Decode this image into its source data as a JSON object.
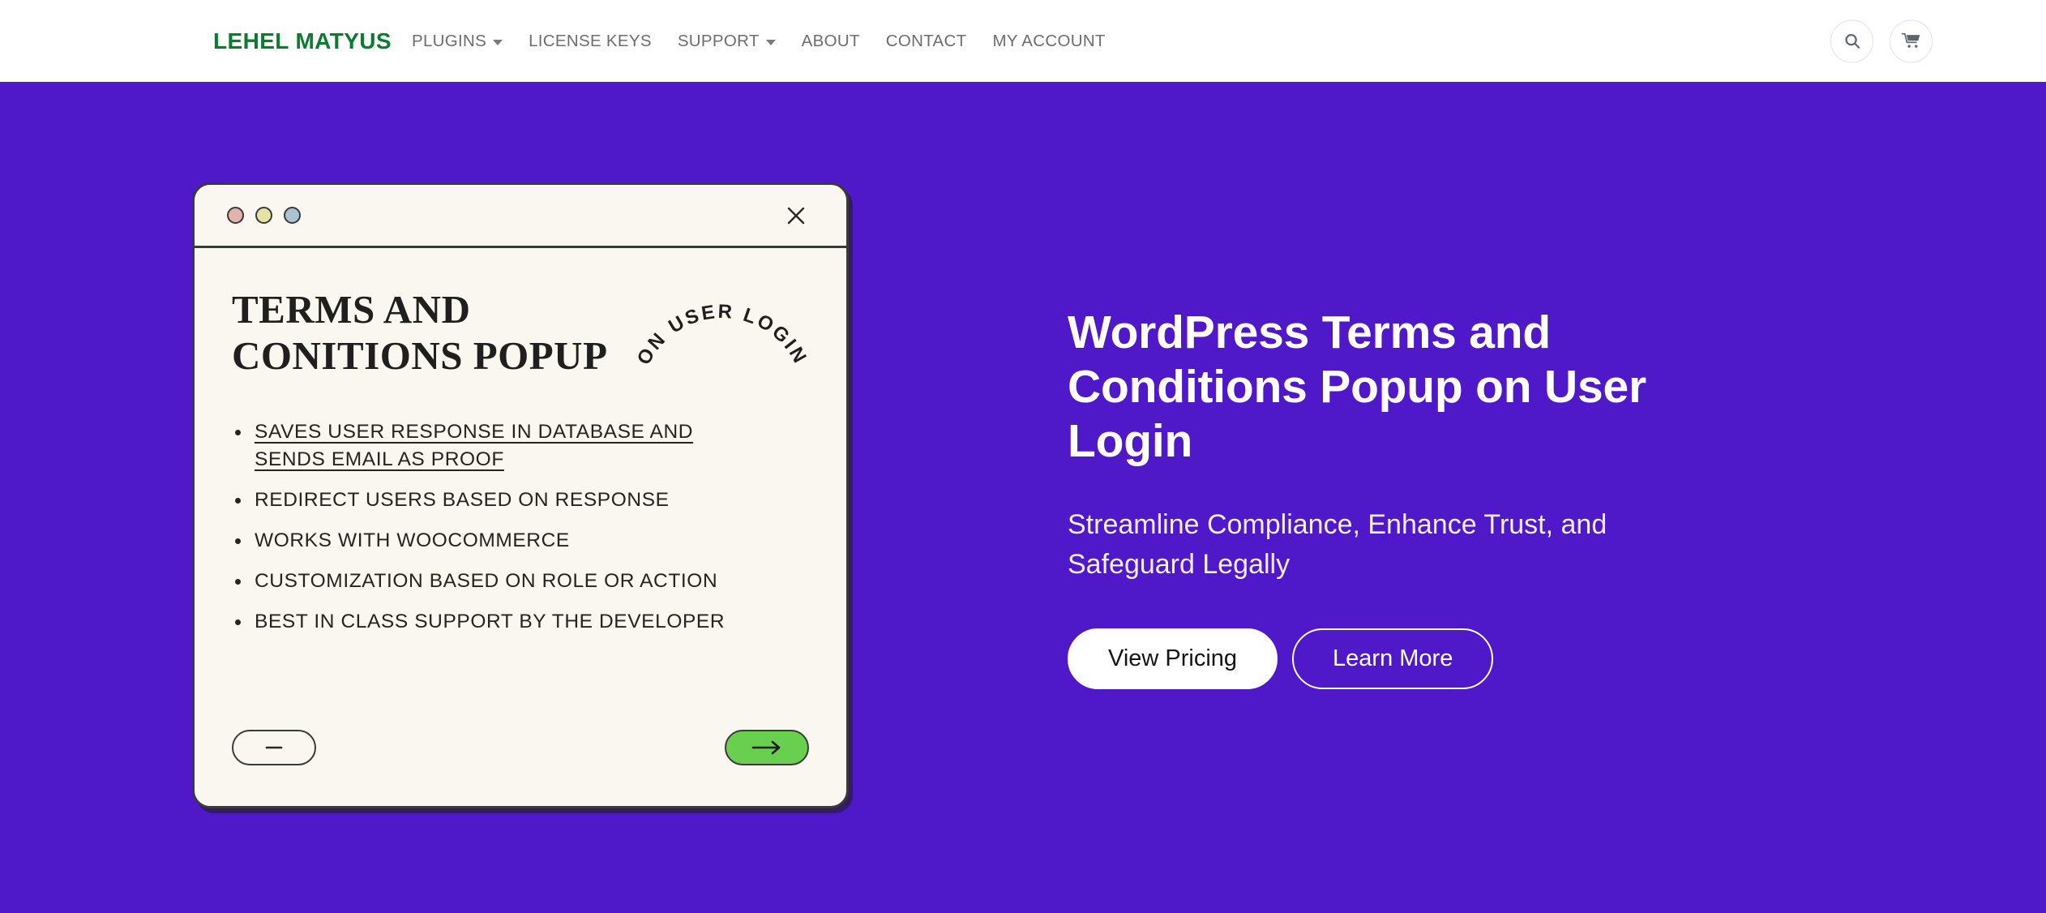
{
  "header": {
    "brand": "LEHEL MATYUS",
    "nav": [
      {
        "label": "PLUGINS",
        "has_dropdown": true
      },
      {
        "label": "LICENSE KEYS",
        "has_dropdown": false
      },
      {
        "label": "SUPPORT",
        "has_dropdown": true
      },
      {
        "label": "ABOUT",
        "has_dropdown": false
      },
      {
        "label": "CONTACT",
        "has_dropdown": false
      },
      {
        "label": "MY ACCOUNT",
        "has_dropdown": false
      }
    ],
    "actions": [
      {
        "icon": "search-icon"
      },
      {
        "icon": "cart-icon"
      }
    ]
  },
  "hero": {
    "background_color": "#4f19c9",
    "title": "WordPress Terms and Conditions Popup on User Login",
    "subtitle": "Streamline Compliance, Enhance Trust, and Safeguard Legally",
    "buttons": [
      {
        "label": "View Pricing",
        "style": "primary"
      },
      {
        "label": "Learn More",
        "style": "secondary"
      }
    ]
  },
  "mockup": {
    "window_controls": [
      {
        "name": "close-dot",
        "color": "#e2b3ae"
      },
      {
        "name": "minimize-dot",
        "color": "#e3e3a4"
      },
      {
        "name": "maximize-dot",
        "color": "#a9c4d0"
      }
    ],
    "close_icon": "close-icon",
    "title": "TERMS AND CONITIONS POPUP",
    "arc_label": "ON USER LOGIN",
    "features": [
      {
        "text": "SAVES USER RESPONSE IN DATABASE AND SENDS EMAIL AS PROOF",
        "underlined": true
      },
      {
        "text": "REDIRECT USERS BASED ON RESPONSE",
        "underlined": false
      },
      {
        "text": "WORKS WITH WOOCOMMERCE",
        "underlined": false
      },
      {
        "text": "CUSTOMIZATION BASED ON ROLE OR ACTION",
        "underlined": false
      },
      {
        "text": "BEST IN CLASS SUPPORT BY THE DEVELOPER",
        "underlined": false
      }
    ],
    "footer": {
      "decline_icon": "minus-icon",
      "accept_icon": "arrow-right-icon",
      "accept_color": "#69cf4f"
    }
  }
}
